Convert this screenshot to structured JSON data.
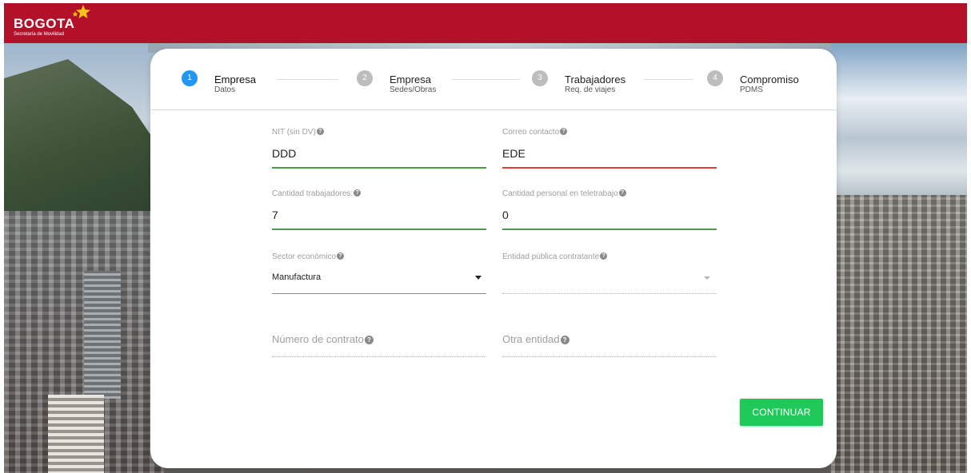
{
  "header": {
    "logo_text": "BOGOTA",
    "logo_subtitle": "Secretaría de Movilidad",
    "bg_color": "#b3102a"
  },
  "stepper": {
    "steps": [
      {
        "number": "1",
        "title": "Empresa",
        "subtitle": "Datos",
        "active": true
      },
      {
        "number": "2",
        "title": "Empresa",
        "subtitle": "Sedes/Obras",
        "active": false
      },
      {
        "number": "3",
        "title": "Trabajadores",
        "subtitle": "Req. de viajes",
        "active": false
      },
      {
        "number": "4",
        "title": "Compromiso",
        "subtitle": "PDMS",
        "active": false
      }
    ],
    "active_color": "#2196f3",
    "inactive_color": "#bdbdbd"
  },
  "form": {
    "nit": {
      "label": "NIT (sin DV)",
      "value": "DDD",
      "state": "valid"
    },
    "correo": {
      "label": "Correo contacto",
      "value": "EDE",
      "state": "invalid"
    },
    "cantidad_trabajadores": {
      "label": "Cantidad trabajadores:",
      "value": "7",
      "state": "valid"
    },
    "teletrabajo": {
      "label": "Cantidad personal en teletrabajo",
      "value": "0",
      "state": "valid"
    },
    "sector": {
      "label": "Sector económico",
      "value": "Manufactura"
    },
    "entidad": {
      "label": "Entidad pública contratante",
      "value": ""
    },
    "contrato": {
      "label": "Número de contrato",
      "value": ""
    },
    "otra_entidad": {
      "label": "Otra entidad",
      "value": ""
    }
  },
  "help_glyph": "?",
  "actions": {
    "continue_label": "CONTINUAR",
    "continue_color": "#1ec95a"
  },
  "colors": {
    "valid": "#43a047",
    "invalid": "#e53935"
  }
}
